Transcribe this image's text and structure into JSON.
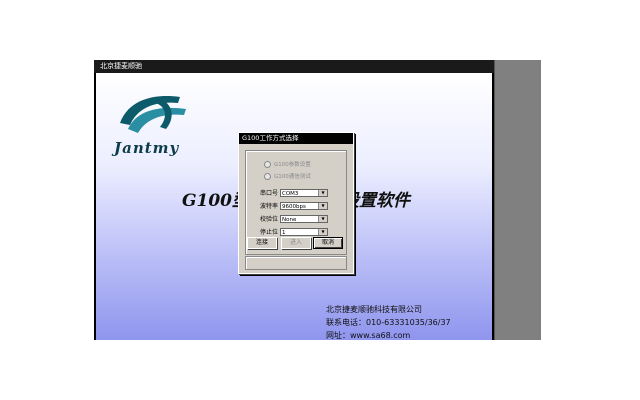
{
  "app": {
    "title": "北京捷麦顺驰",
    "logo_text": "Jantmy",
    "main_title_left": "G100型",
    "main_title_right": "设置软件",
    "company_name": "北京捷麦顺驰科技有限公司",
    "phone": "联系电话：010-63331035/36/37",
    "website": "网址：www.sa68.com"
  },
  "dialog": {
    "title": "G100工作方式选择",
    "radio_options": [
      {
        "label": "G100参数设置",
        "enabled": false
      },
      {
        "label": "G100通信测试",
        "enabled": false
      }
    ],
    "fields": [
      {
        "label": "串口号",
        "value": "COM3"
      },
      {
        "label": "波特率",
        "value": "9600bps"
      },
      {
        "label": "校验位",
        "value": "None"
      },
      {
        "label": "停止位",
        "value": "1"
      }
    ],
    "buttons": {
      "connect": "连接",
      "enter": "进入",
      "cancel": "取消"
    }
  },
  "colors": {
    "logo_teal": "#0d5a6b",
    "client_gradient_bottom": "#8f95ee",
    "dialog_face": "#d4d0c8"
  },
  "icons": {
    "logo": "jantmy-logo-icon",
    "dropdown": "chevron-down-icon"
  }
}
